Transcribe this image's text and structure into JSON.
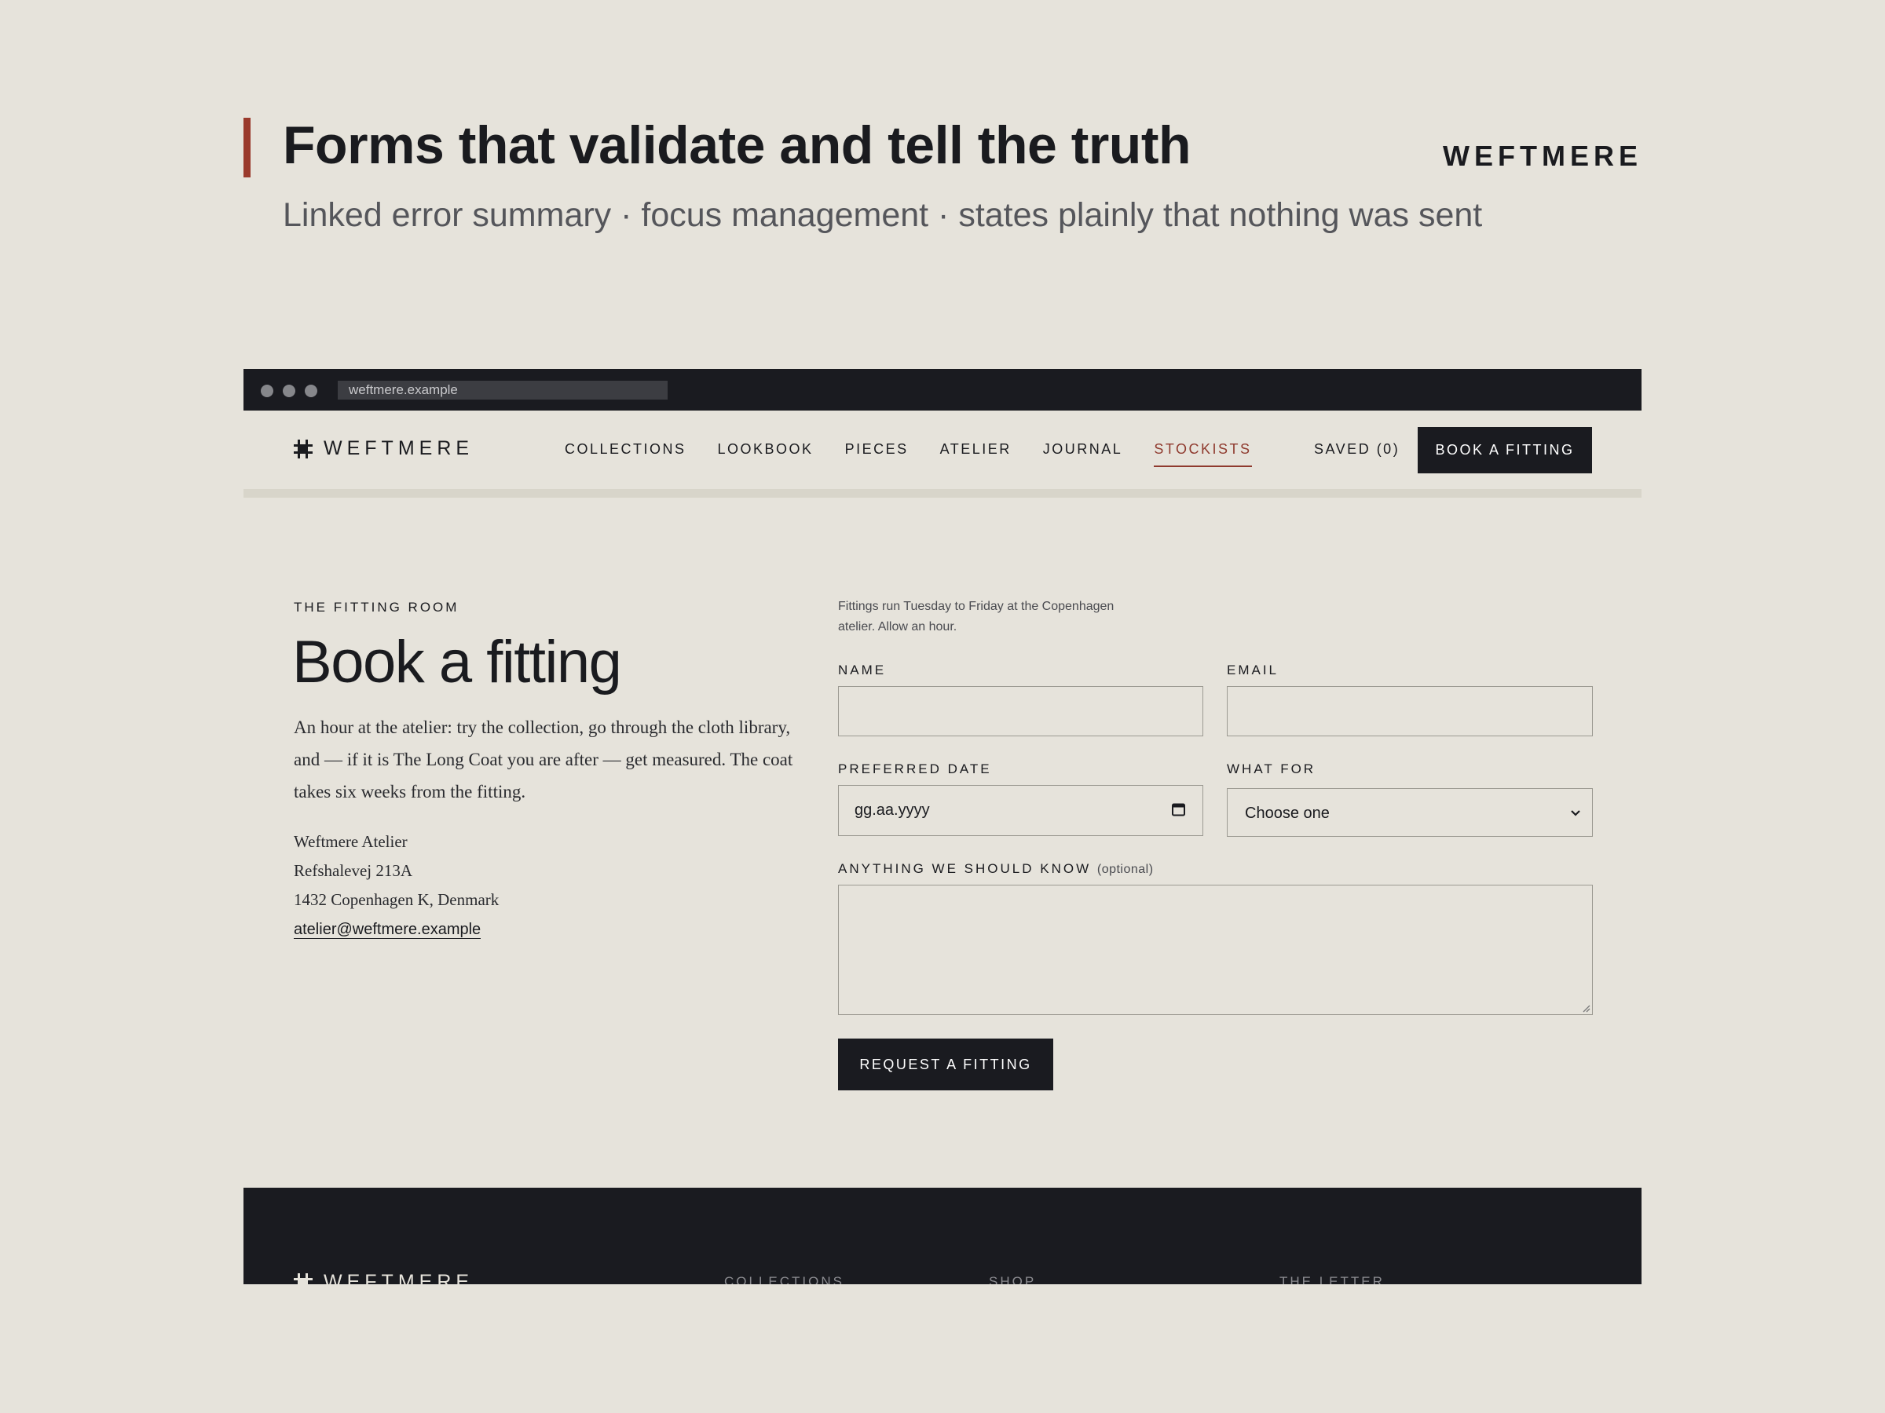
{
  "slide": {
    "title": "Forms that validate and tell the truth",
    "brand": "WEFTMERE",
    "subtitle": "Linked error summary · focus management · states plainly that nothing was sent",
    "accent_color": "#9a3a2c"
  },
  "browser": {
    "url": "weftmere.example"
  },
  "site": {
    "logo_text": "WEFTMERE",
    "nav": [
      {
        "label": "COLLECTIONS"
      },
      {
        "label": "LOOKBOOK"
      },
      {
        "label": "PIECES"
      },
      {
        "label": "ATELIER"
      },
      {
        "label": "JOURNAL"
      },
      {
        "label": "STOCKISTS",
        "active": true
      }
    ],
    "saved_label": "SAVED (0)",
    "cta_label": "BOOK A FITTING",
    "active_color": "#8f3a2e"
  },
  "page": {
    "eyebrow": "THE FITTING ROOM",
    "heading": "Book a fitting",
    "intro": "An hour at the atelier: try the collection, go through the cloth library, and — if it is The Long Coat you are after — get measured. The coat takes six weeks from the fitting.",
    "address": {
      "line1": "Weftmere Atelier",
      "line2": "Refshalevej 213A",
      "line3": "1432 Copenhagen K, Denmark",
      "email": "atelier@weftmere.example"
    }
  },
  "form": {
    "note": "Fittings run Tuesday to Friday at the Copenhagen atelier. Allow an hour.",
    "name_label": "NAME",
    "name_value": "",
    "email_label": "EMAIL",
    "email_value": "",
    "date_label": "PREFERRED DATE",
    "date_value": "gg.aa.yyyy",
    "purpose_label": "WHAT FOR",
    "purpose_value": "Choose one",
    "notes_label": "ANYTHING WE SHOULD KNOW",
    "notes_optional": "(optional)",
    "notes_value": "",
    "submit_label": "REQUEST A FITTING"
  },
  "footer": {
    "logo_text": "WEFTMERE",
    "columns": [
      {
        "label": "COLLECTIONS"
      },
      {
        "label": "SHOP"
      },
      {
        "label": "THE LETTER"
      }
    ]
  },
  "icons": [
    "logo-mark-icon",
    "calendar-icon",
    "chevron-down-icon",
    "resize-grip-icon"
  ]
}
